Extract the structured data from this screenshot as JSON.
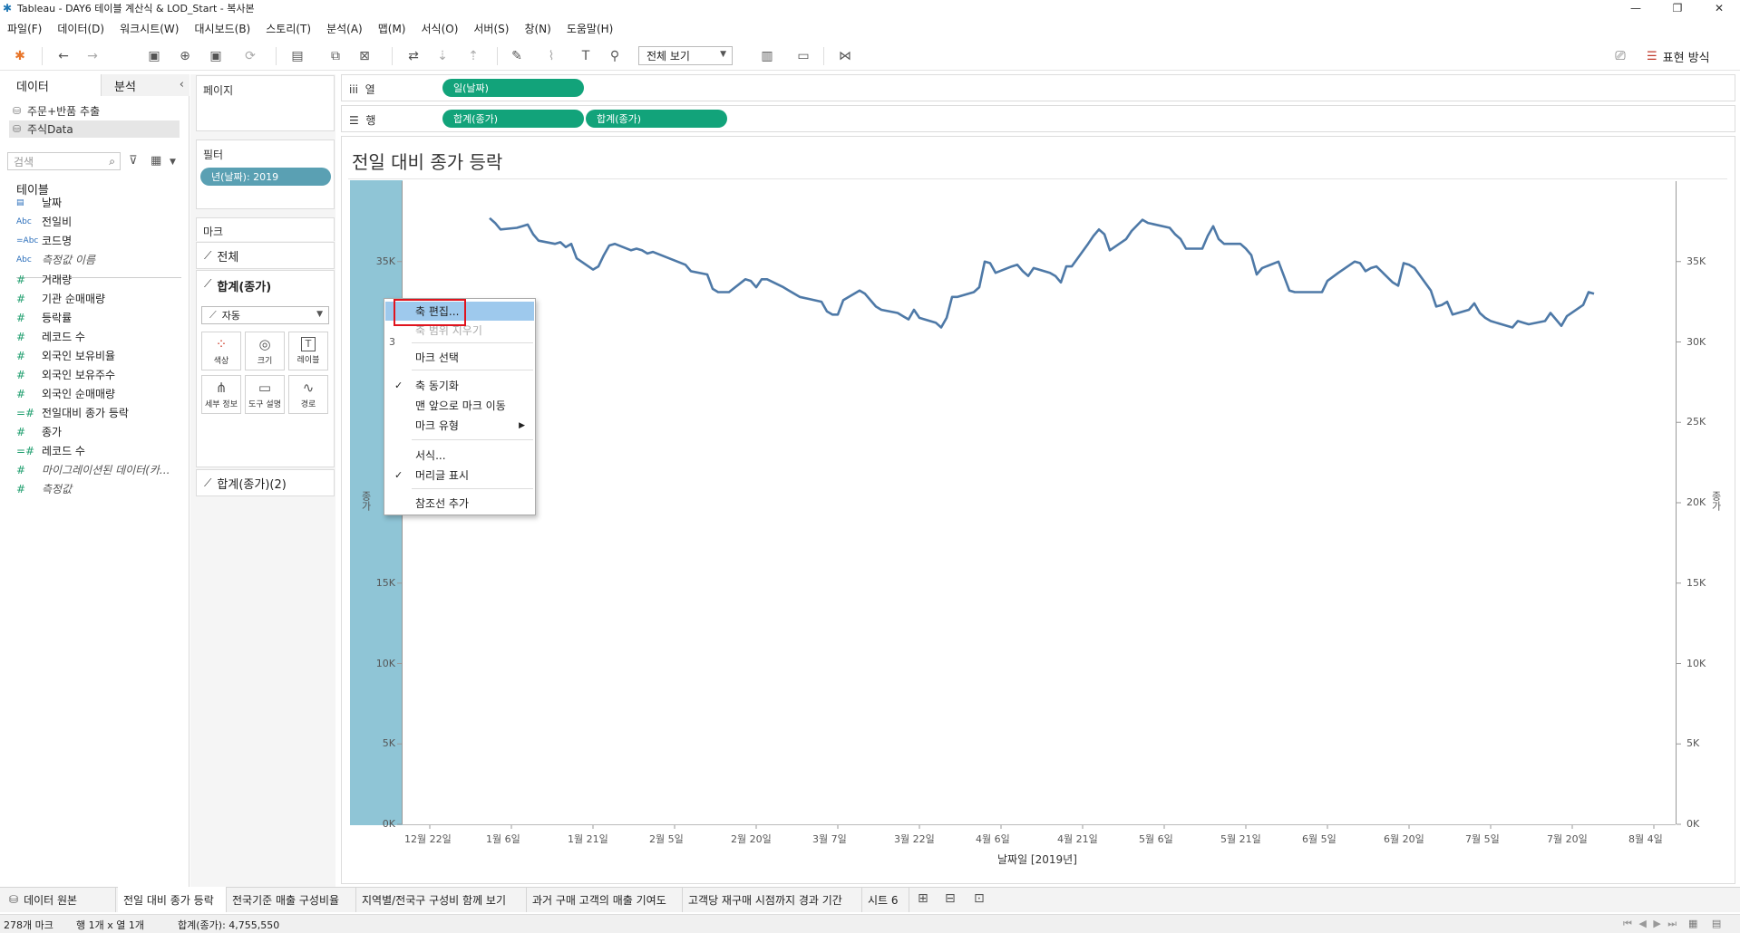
{
  "window": {
    "title": "Tableau - DAY6 테이블 계산식 & LOD_Start - 복사본",
    "min_symbol": "—",
    "max_symbol": "❐",
    "close_symbol": "✕"
  },
  "menu": [
    "파일(F)",
    "데이터(D)",
    "워크시트(W)",
    "대시보드(B)",
    "스토리(T)",
    "분석(A)",
    "맵(M)",
    "서식(O)",
    "서버(S)",
    "창(N)",
    "도움말(H)"
  ],
  "toolbar": {
    "view_select": "전체 보기",
    "show_me": "표현 방식",
    "icons": {
      "logo": "✱",
      "undo": "←",
      "redo": "→",
      "save": "▣",
      "add_ds": "⊕",
      "refresh": "⟳",
      "new_sheet": "▤",
      "dup": "⧉",
      "clear": "⊠",
      "swap": "⇄",
      "sort_asc": "⇣",
      "sort_desc": "⇡",
      "highlight": "✎",
      "attach": "⌇",
      "label": "T",
      "pin": "⚲",
      "chart": "▥",
      "present": "▭",
      "share": "⋈",
      "brush": "⎚"
    }
  },
  "datapane": {
    "tab_data": "데이터",
    "tab_analysis": "분석",
    "collapse": "‹",
    "datasources": [
      {
        "label": "주문+반품 추출",
        "icon": "⛁"
      },
      {
        "label": "주식Data",
        "icon": "⛁"
      }
    ],
    "search_placeholder": "검색",
    "search_icon": "⌕",
    "filter_icon": "⊽",
    "grid_icon": "▦",
    "tables_header": "테이블",
    "fields": [
      {
        "label": "날짜",
        "icon": "▤",
        "kind": "dim"
      },
      {
        "label": "전일비",
        "icon": "Abc",
        "kind": "dim"
      },
      {
        "label": "코드명",
        "icon": "=Abc",
        "kind": "dim"
      },
      {
        "label": "측정값 이름",
        "icon": "Abc",
        "kind": "dim",
        "italic": true
      },
      {
        "label": "거래량",
        "icon": "#",
        "kind": "meas"
      },
      {
        "label": "기관 순매매량",
        "icon": "#",
        "kind": "meas"
      },
      {
        "label": "등락률",
        "icon": "#",
        "kind": "meas"
      },
      {
        "label": "레코드 수",
        "icon": "#",
        "kind": "meas"
      },
      {
        "label": "외국인 보유비율",
        "icon": "#",
        "kind": "meas"
      },
      {
        "label": "외국인 보유주수",
        "icon": "#",
        "kind": "meas"
      },
      {
        "label": "외국인 순매매량",
        "icon": "#",
        "kind": "meas"
      },
      {
        "label": "전일대비 종가 등락",
        "icon": "=#",
        "kind": "meas"
      },
      {
        "label": "종가",
        "icon": "#",
        "kind": "meas"
      },
      {
        "label": "레코드 수",
        "icon": "=#",
        "kind": "meas"
      },
      {
        "label": "마이그레이션된 데이터(카...",
        "icon": "#",
        "kind": "meas",
        "italic": true
      },
      {
        "label": "측정값",
        "icon": "#",
        "kind": "meas",
        "italic": true
      }
    ]
  },
  "shelves": {
    "pages_title": "페이지",
    "filters_title": "필터",
    "filter_pill": "년(날짜): 2019",
    "marks_title": "마크",
    "marks_all": "전체",
    "marks_sum": "합계(종가)",
    "marks_sum2": "합계(종가)(2)",
    "mark_type": "자동",
    "mark_buttons": [
      {
        "icon": "⁘",
        "label": "색상"
      },
      {
        "icon": "◎",
        "label": "크기"
      },
      {
        "icon": "T",
        "label": "레이블"
      },
      {
        "icon": "⋔",
        "label": "세부 정보"
      },
      {
        "icon": "▭",
        "label": "도구 설명"
      },
      {
        "icon": "∿",
        "label": "경로"
      }
    ],
    "columns_label": "열",
    "columns_icon": "iii",
    "rows_label": "행",
    "rows_icon": "☰",
    "column_pills": [
      "일(날짜)"
    ],
    "row_pills": [
      "합계(종가)",
      "합계(종가)"
    ]
  },
  "view": {
    "title": "전일 대비 종가 등락",
    "ylabel_left": "종가",
    "ylabel_right": "종가"
  },
  "chart_data": {
    "type": "line",
    "title": "전일 대비 종가 등락",
    "xlabel": "날짜일 [2019년]",
    "ylabel": "종가",
    "ylim": [
      0,
      40000
    ],
    "grid": false,
    "y_ticks": [
      "0K",
      "5K",
      "10K",
      "15K",
      "20K",
      "25K",
      "30K",
      "35K"
    ],
    "y_ticks_left_visible": [
      "0K",
      "5K",
      "10K",
      "15K",
      "",
      "",
      "3",
      "35K"
    ],
    "x_ticks": [
      "12월 22일",
      "1월 6일",
      "1월 21일",
      "2월 5일",
      "2월 20일",
      "3월 7일",
      "3월 22일",
      "4월 6일",
      "4월 21일",
      "5월 6일",
      "5월 21일",
      "6월 5일",
      "6월 20일",
      "7월 5일",
      "7월 20일",
      "8월 4일"
    ],
    "series": [
      {
        "name": "합계(종가)",
        "color": "#4e79a7",
        "points": [
          [
            "2019-01-02",
            37700
          ],
          [
            "2019-01-03",
            37400
          ],
          [
            "2019-01-04",
            37000
          ],
          [
            "2019-01-07",
            37100
          ],
          [
            "2019-01-08",
            37200
          ],
          [
            "2019-01-09",
            37300
          ],
          [
            "2019-01-10",
            36700
          ],
          [
            "2019-01-11",
            36300
          ],
          [
            "2019-01-14",
            36100
          ],
          [
            "2019-01-15",
            36200
          ],
          [
            "2019-01-16",
            35900
          ],
          [
            "2019-01-17",
            36100
          ],
          [
            "2019-01-18",
            35200
          ],
          [
            "2019-01-21",
            34500
          ],
          [
            "2019-01-22",
            34700
          ],
          [
            "2019-01-23",
            35400
          ],
          [
            "2019-01-24",
            36000
          ],
          [
            "2019-01-25",
            36100
          ],
          [
            "2019-01-28",
            35700
          ],
          [
            "2019-01-29",
            35800
          ],
          [
            "2019-01-30",
            35700
          ],
          [
            "2019-01-31",
            35500
          ],
          [
            "2019-02-01",
            35600
          ],
          [
            "2019-02-07",
            34800
          ],
          [
            "2019-02-08",
            34400
          ],
          [
            "2019-02-11",
            34200
          ],
          [
            "2019-02-12",
            33300
          ],
          [
            "2019-02-13",
            33100
          ],
          [
            "2019-02-14",
            33100
          ],
          [
            "2019-02-15",
            33100
          ],
          [
            "2019-02-18",
            33900
          ],
          [
            "2019-02-19",
            33800
          ],
          [
            "2019-02-20",
            33400
          ],
          [
            "2019-02-21",
            33900
          ],
          [
            "2019-02-22",
            33900
          ],
          [
            "2019-02-25",
            33400
          ],
          [
            "2019-02-26",
            33200
          ],
          [
            "2019-02-27",
            33000
          ],
          [
            "2019-02-28",
            32800
          ],
          [
            "2019-03-04",
            32500
          ],
          [
            "2019-03-05",
            31900
          ],
          [
            "2019-03-06",
            31700
          ],
          [
            "2019-03-07",
            31700
          ],
          [
            "2019-03-08",
            32600
          ],
          [
            "2019-03-11",
            33200
          ],
          [
            "2019-03-12",
            33000
          ],
          [
            "2019-03-13",
            32600
          ],
          [
            "2019-03-14",
            32200
          ],
          [
            "2019-03-15",
            32000
          ],
          [
            "2019-03-18",
            31800
          ],
          [
            "2019-03-19",
            31600
          ],
          [
            "2019-03-20",
            31400
          ],
          [
            "2019-03-21",
            32000
          ],
          [
            "2019-03-22",
            31500
          ],
          [
            "2019-03-25",
            31200
          ],
          [
            "2019-03-26",
            30900
          ],
          [
            "2019-03-27",
            31500
          ],
          [
            "2019-03-28",
            32800
          ],
          [
            "2019-03-29",
            32800
          ],
          [
            "2019-04-01",
            33100
          ],
          [
            "2019-04-02",
            33400
          ],
          [
            "2019-04-03",
            35000
          ],
          [
            "2019-04-04",
            34900
          ],
          [
            "2019-04-05",
            34300
          ],
          [
            "2019-04-08",
            34700
          ],
          [
            "2019-04-09",
            34800
          ],
          [
            "2019-04-10",
            34400
          ],
          [
            "2019-04-11",
            34100
          ],
          [
            "2019-04-12",
            34600
          ],
          [
            "2019-04-15",
            34300
          ],
          [
            "2019-04-16",
            34100
          ],
          [
            "2019-04-17",
            33700
          ],
          [
            "2019-04-18",
            34700
          ],
          [
            "2019-04-19",
            34700
          ],
          [
            "2019-04-22",
            36100
          ],
          [
            "2019-04-23",
            36600
          ],
          [
            "2019-04-24",
            37000
          ],
          [
            "2019-04-25",
            36700
          ],
          [
            "2019-04-26",
            35700
          ],
          [
            "2019-04-29",
            36400
          ],
          [
            "2019-04-30",
            36900
          ],
          [
            "2019-05-02",
            37600
          ],
          [
            "2019-05-03",
            37400
          ],
          [
            "2019-05-07",
            37100
          ],
          [
            "2019-05-08",
            36700
          ],
          [
            "2019-05-09",
            36400
          ],
          [
            "2019-05-10",
            35800
          ],
          [
            "2019-05-13",
            35800
          ],
          [
            "2019-05-14",
            36600
          ],
          [
            "2019-05-15",
            37200
          ],
          [
            "2019-05-16",
            36400
          ],
          [
            "2019-05-17",
            36100
          ],
          [
            "2019-05-20",
            36100
          ],
          [
            "2019-05-21",
            35800
          ],
          [
            "2019-05-22",
            35400
          ],
          [
            "2019-05-23",
            34200
          ],
          [
            "2019-05-24",
            34600
          ],
          [
            "2019-05-27",
            35000
          ],
          [
            "2019-05-28",
            34100
          ],
          [
            "2019-05-29",
            33200
          ],
          [
            "2019-05-30",
            33100
          ],
          [
            "2019-05-31",
            33100
          ],
          [
            "2019-06-03",
            33100
          ],
          [
            "2019-06-04",
            33100
          ],
          [
            "2019-06-05",
            33800
          ],
          [
            "2019-06-07",
            34300
          ],
          [
            "2019-06-10",
            35000
          ],
          [
            "2019-06-11",
            34900
          ],
          [
            "2019-06-12",
            34400
          ],
          [
            "2019-06-13",
            34600
          ],
          [
            "2019-06-14",
            34700
          ],
          [
            "2019-06-17",
            33700
          ],
          [
            "2019-06-18",
            33500
          ],
          [
            "2019-06-19",
            34900
          ],
          [
            "2019-06-20",
            34800
          ],
          [
            "2019-06-21",
            34600
          ],
          [
            "2019-06-24",
            33200
          ],
          [
            "2019-06-25",
            32200
          ],
          [
            "2019-06-26",
            32300
          ],
          [
            "2019-06-27",
            32500
          ],
          [
            "2019-06-28",
            31700
          ],
          [
            "2019-07-01",
            32000
          ],
          [
            "2019-07-02",
            32400
          ],
          [
            "2019-07-03",
            31800
          ],
          [
            "2019-07-04",
            31500
          ],
          [
            "2019-07-05",
            31300
          ],
          [
            "2019-07-08",
            31000
          ],
          [
            "2019-07-09",
            30900
          ],
          [
            "2019-07-10",
            31300
          ],
          [
            "2019-07-11",
            31200
          ],
          [
            "2019-07-12",
            31100
          ],
          [
            "2019-07-15",
            31300
          ],
          [
            "2019-07-16",
            31800
          ],
          [
            "2019-07-17",
            31400
          ],
          [
            "2019-07-18",
            31000
          ],
          [
            "2019-07-19",
            31600
          ],
          [
            "2019-07-22",
            32300
          ],
          [
            "2019-07-23",
            33100
          ],
          [
            "2019-07-24",
            33000
          ]
        ]
      }
    ]
  },
  "context_menu": {
    "items": [
      {
        "label": "축 편집...",
        "highlight": true,
        "check": ""
      },
      {
        "label": "축 범위 지우기",
        "disabled": true,
        "check": ""
      },
      {
        "label": "마크 선택",
        "check": ""
      },
      {
        "label": "축 동기화",
        "check": "✓"
      },
      {
        "label": "맨 앞으로 마크 이동",
        "check": ""
      },
      {
        "label": "마크 유형",
        "check": "",
        "submenu": "▶"
      },
      {
        "label": "서식...",
        "check": ""
      },
      {
        "label": "머리글 표시",
        "check": "✓"
      },
      {
        "label": "참조선 추가",
        "check": ""
      }
    ]
  },
  "sheet_tabs": {
    "data_source": "데이터 원본",
    "tabs": [
      "전일 대비 종가 등락",
      "전국기준 매출 구성비율",
      "지역별/전국구 구성비 함께 보기",
      "과거 구매 고객의 매출 기여도",
      "고객당 재구매 시점까지 경과 기간",
      "시트 6"
    ],
    "new_sheet_icon": "⊞",
    "new_dash_icon": "⊟",
    "new_story_icon": "⊡"
  },
  "status": {
    "marks": "278개 마크",
    "rows_cols": "행 1개 x 열 1개",
    "sum": "합계(종가): 4,755,550",
    "nav": "⏮ ◀ ▶ ⏭",
    "view_icons": "▦ ▤"
  }
}
